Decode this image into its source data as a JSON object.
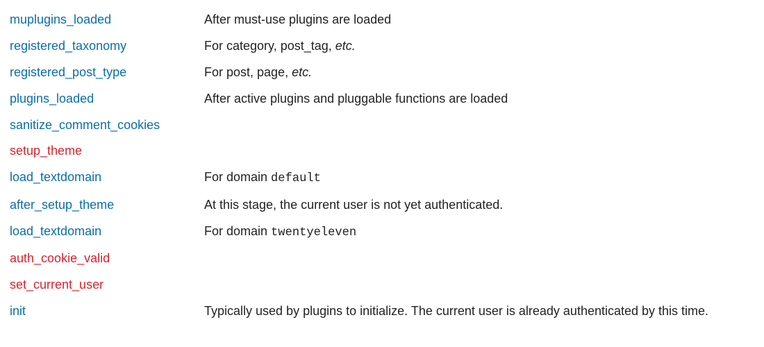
{
  "hooks": [
    {
      "name": "muplugins_loaded",
      "color": "blue",
      "desc": [
        {
          "t": "After must-use plugins are loaded"
        }
      ]
    },
    {
      "name": "registered_taxonomy",
      "color": "blue",
      "desc": [
        {
          "t": "For category, post_tag, "
        },
        {
          "t": "etc.",
          "italic": true
        }
      ]
    },
    {
      "name": "registered_post_type",
      "color": "blue",
      "desc": [
        {
          "t": "For post, page, "
        },
        {
          "t": "etc.",
          "italic": true
        }
      ]
    },
    {
      "name": "plugins_loaded",
      "color": "blue",
      "desc": [
        {
          "t": "After active plugins and pluggable functions are loaded"
        }
      ]
    },
    {
      "name": "sanitize_comment_cookies",
      "color": "blue",
      "desc": []
    },
    {
      "name": "setup_theme",
      "color": "red",
      "desc": []
    },
    {
      "name": "load_textdomain",
      "color": "blue",
      "desc": [
        {
          "t": "For domain "
        },
        {
          "t": "default",
          "code": true
        }
      ]
    },
    {
      "name": "after_setup_theme",
      "color": "blue",
      "desc": [
        {
          "t": "At this stage, the current user is not yet authenticated."
        }
      ]
    },
    {
      "name": "load_textdomain",
      "color": "blue",
      "desc": [
        {
          "t": "For domain "
        },
        {
          "t": "twentyeleven",
          "code": true
        }
      ]
    },
    {
      "name": "auth_cookie_valid",
      "color": "red",
      "desc": []
    },
    {
      "name": "set_current_user",
      "color": "red",
      "desc": []
    },
    {
      "name": "init",
      "color": "blue",
      "desc": [
        {
          "t": "Typically used by plugins to initialize. The current user is already authenticated by this time."
        }
      ]
    }
  ]
}
